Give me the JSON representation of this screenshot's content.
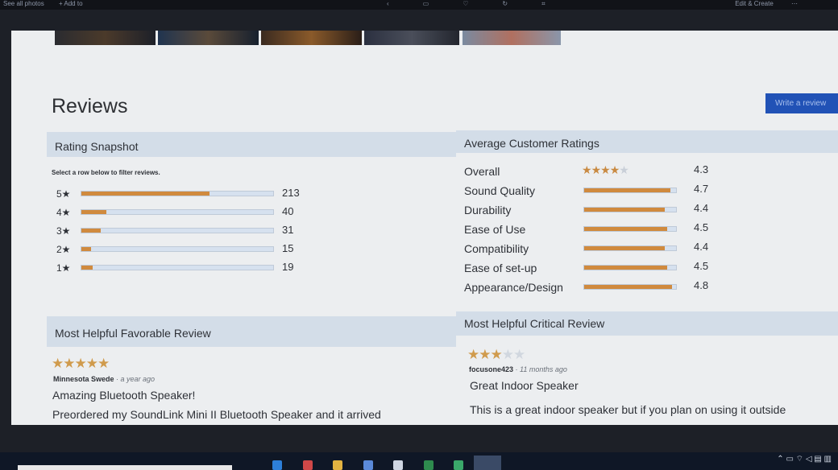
{
  "topbar": {
    "see_all_photos": "See all photos",
    "add_to": "+ Add to",
    "edit_create": "Edit & Create",
    "icons": [
      "back-icon",
      "slideshow-icon",
      "heart-icon",
      "rotate-icon",
      "crop-icon"
    ]
  },
  "reviews": {
    "title": "Reviews",
    "write_button": "Write a review"
  },
  "snapshot": {
    "header": "Rating Snapshot",
    "hint": "Select a row below to filter reviews.",
    "rows": [
      {
        "stars": "5★",
        "count": "213",
        "fraction": 0.67
      },
      {
        "stars": "4★",
        "count": "40",
        "fraction": 0.13
      },
      {
        "stars": "3★",
        "count": "31",
        "fraction": 0.1
      },
      {
        "stars": "2★",
        "count": "15",
        "fraction": 0.05
      },
      {
        "stars": "1★",
        "count": "19",
        "fraction": 0.06
      }
    ]
  },
  "average": {
    "header": "Average Customer Ratings",
    "overall": {
      "label": "Overall",
      "value": "4.3",
      "stars_filled": 4
    },
    "rows": [
      {
        "label": "Sound Quality",
        "value": "4.7",
        "fraction": 0.94
      },
      {
        "label": "Durability",
        "value": "4.4",
        "fraction": 0.88
      },
      {
        "label": "Ease of Use",
        "value": "4.5",
        "fraction": 0.9
      },
      {
        "label": "Compatibility",
        "value": "4.4",
        "fraction": 0.88
      },
      {
        "label": "Ease of set-up",
        "value": "4.5",
        "fraction": 0.9
      },
      {
        "label": "Appearance/Design",
        "value": "4.8",
        "fraction": 0.96
      }
    ]
  },
  "favorable": {
    "header": "Most Helpful Favorable Review",
    "stars_filled": 5,
    "author": "Minnesota Swede",
    "age": "· a year ago",
    "title": "Amazing Bluetooth Speaker!",
    "body": "Preordered my SoundLink Mini II Bluetooth Speaker and it arrived"
  },
  "critical": {
    "header": "Most Helpful Critical Review",
    "stars_filled": 3,
    "author": "focusone423",
    "age": "· 11 months ago",
    "title": "Great Indoor Speaker",
    "body": "This is a great indoor speaker but if you plan on using it outside"
  },
  "colors": {
    "bar_fill": "#d08a3e",
    "bar_track": "#d6e1ef",
    "section_header": "#d3dde8",
    "write_button": "#2152b6",
    "star_on": "#d09b4d"
  }
}
